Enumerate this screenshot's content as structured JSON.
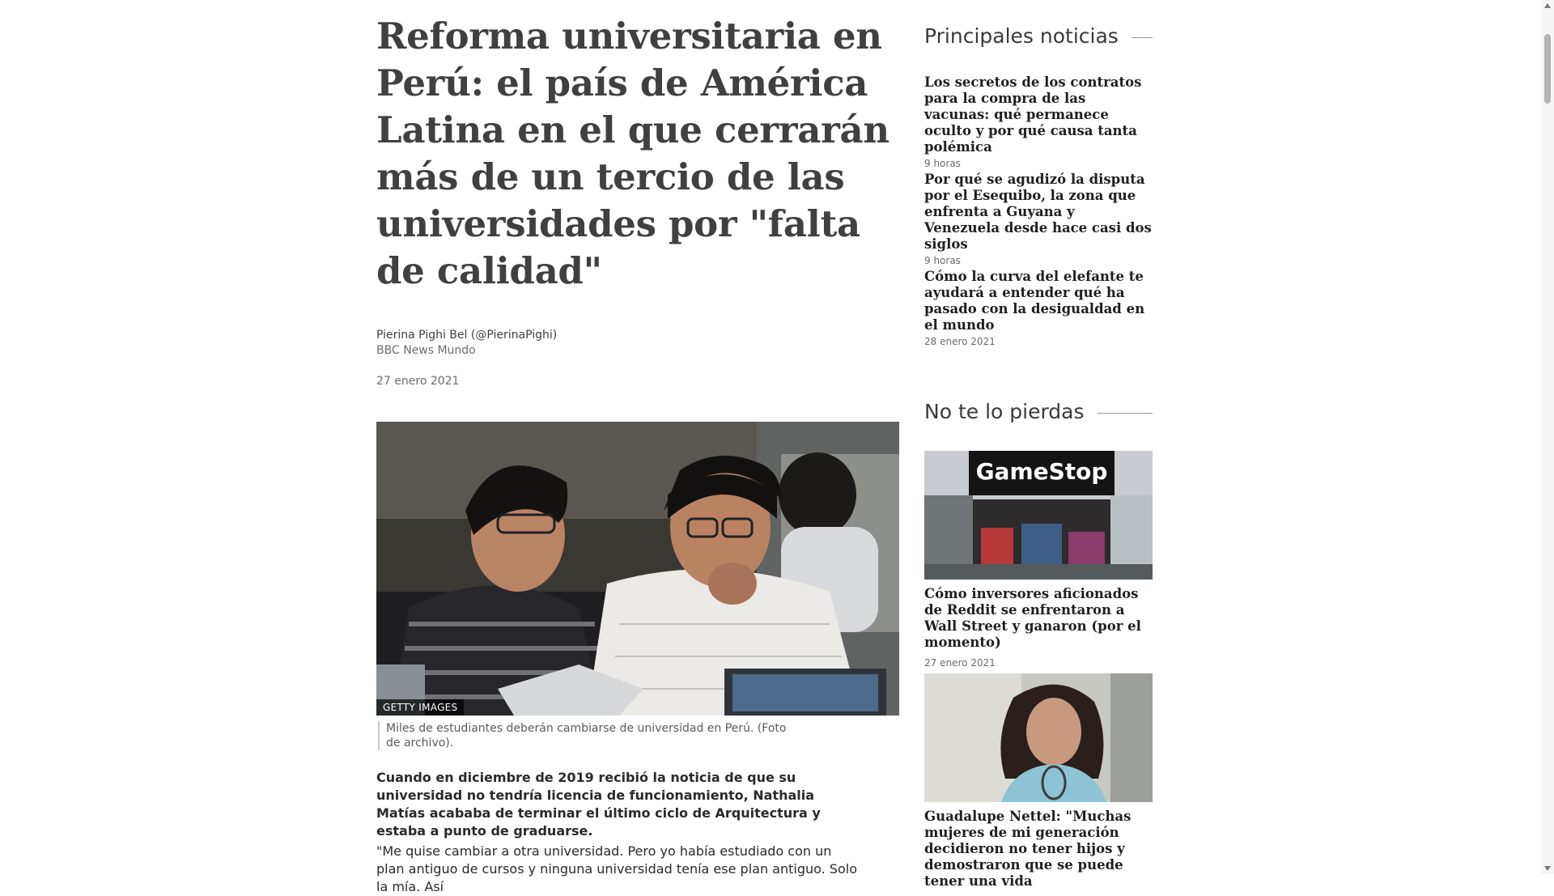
{
  "article": {
    "headline": "Reforma universitaria en Perú: el país de América Latina en el que cerrarán más de un tercio de las universidades por \"falta de calidad\"",
    "author": "Pierina Pighi Bel (@PierinaPighi)",
    "outlet": "BBC News Mundo",
    "date": "27 enero 2021",
    "image_credit": "GETTY IMAGES",
    "image_caption": "Miles de estudiantes deberán cambiarse de universidad en Perú. (Foto de archivo).",
    "lead": "Cuando en diciembre de 2019 recibió la noticia de que su universidad no tendría licencia de funcionamiento, Nathalia Matías acababa de terminar el último ciclo de Arquitectura y estaba a punto de graduarse.",
    "paragraph_1": "\"Me quise cambiar a otra universidad. Pero yo había estudiado con un plan antiguo de cursos y ninguna universidad tenía ese plan antiguo. Solo la mía. Así"
  },
  "sidebar": {
    "top_stories": {
      "heading": "Principales noticias",
      "items": [
        {
          "title": "Los secretos de los contratos para la compra de las vacunas: qué permanece oculto y por qué causa tanta polémica",
          "time": "9 horas"
        },
        {
          "title": "Por qué se agudizó la disputa por el Esequibo, la zona que enfrenta a Guyana y Venezuela desde hace casi dos siglos",
          "time": "9 horas"
        },
        {
          "title": "Cómo la curva del elefante te ayudará a entender qué ha pasado con la desigualdad en el mundo",
          "time": "28 enero 2021"
        }
      ]
    },
    "dont_miss": {
      "heading": "No te lo pierdas",
      "items": [
        {
          "title": "Cómo inversores aficionados de Reddit se enfrentaron a Wall Street y ganaron (por el momento)",
          "time": "27 enero 2021",
          "sign_text": "GameStop"
        },
        {
          "title": "Guadalupe Nettel: \"Muchas mujeres de mi generación decidieron no tener hijos y demostraron que se puede tener una vida",
          "time": ""
        }
      ]
    }
  }
}
